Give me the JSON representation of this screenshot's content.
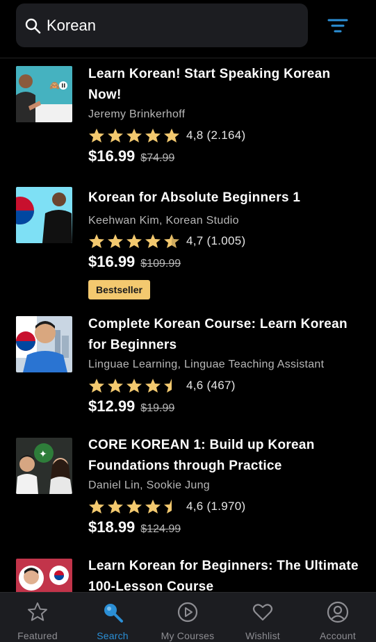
{
  "search": {
    "value": "Korean",
    "placeholder": "Search"
  },
  "courses": [
    {
      "title": "Learn Korean! Start Speaking Korean Now!",
      "author": "Jeremy Brinkerhoff",
      "rating": "4,8",
      "rating_value": 4.8,
      "count": "(2.164)",
      "price": "$16.99",
      "old_price": "$74.99",
      "badge": ""
    },
    {
      "title": "Korean for Absolute Beginners 1",
      "author": "Keehwan Kim, Korean Studio",
      "rating": "4,7",
      "rating_value": 4.7,
      "count": "(1.005)",
      "price": "$16.99",
      "old_price": "$109.99",
      "badge": "Bestseller"
    },
    {
      "title": "Complete Korean Course: Learn Korean for Beginners",
      "author": "Linguae Learning, Linguae Teaching Assistant",
      "rating": "4,6",
      "rating_value": 4.6,
      "count": "(467)",
      "price": "$12.99",
      "old_price": "$19.99",
      "badge": ""
    },
    {
      "title": "CORE KOREAN 1: Build up Korean Foundations through Practice",
      "author": "Daniel Lin, Sookie Jung",
      "rating": "4,6",
      "rating_value": 4.6,
      "count": "(1.970)",
      "price": "$18.99",
      "old_price": "$124.99",
      "badge": ""
    },
    {
      "title": "Learn Korean for Beginners: The Ultimate 100-Lesson Course",
      "author": "",
      "rating": "",
      "count": "",
      "price": "",
      "old_price": "",
      "badge": ""
    }
  ],
  "tabs": [
    {
      "label": "Featured",
      "icon": "star-icon",
      "active": false
    },
    {
      "label": "Search",
      "icon": "search-icon",
      "active": true
    },
    {
      "label": "My Courses",
      "icon": "play-circle-icon",
      "active": false
    },
    {
      "label": "Wishlist",
      "icon": "heart-icon",
      "active": false
    },
    {
      "label": "Account",
      "icon": "account-icon",
      "active": false
    }
  ],
  "colors": {
    "background": "#000000",
    "star": "#f3c96f",
    "badge": "#f3c96f",
    "active_tab": "#2b8fd6",
    "inactive_tab": "#8e8e93"
  }
}
